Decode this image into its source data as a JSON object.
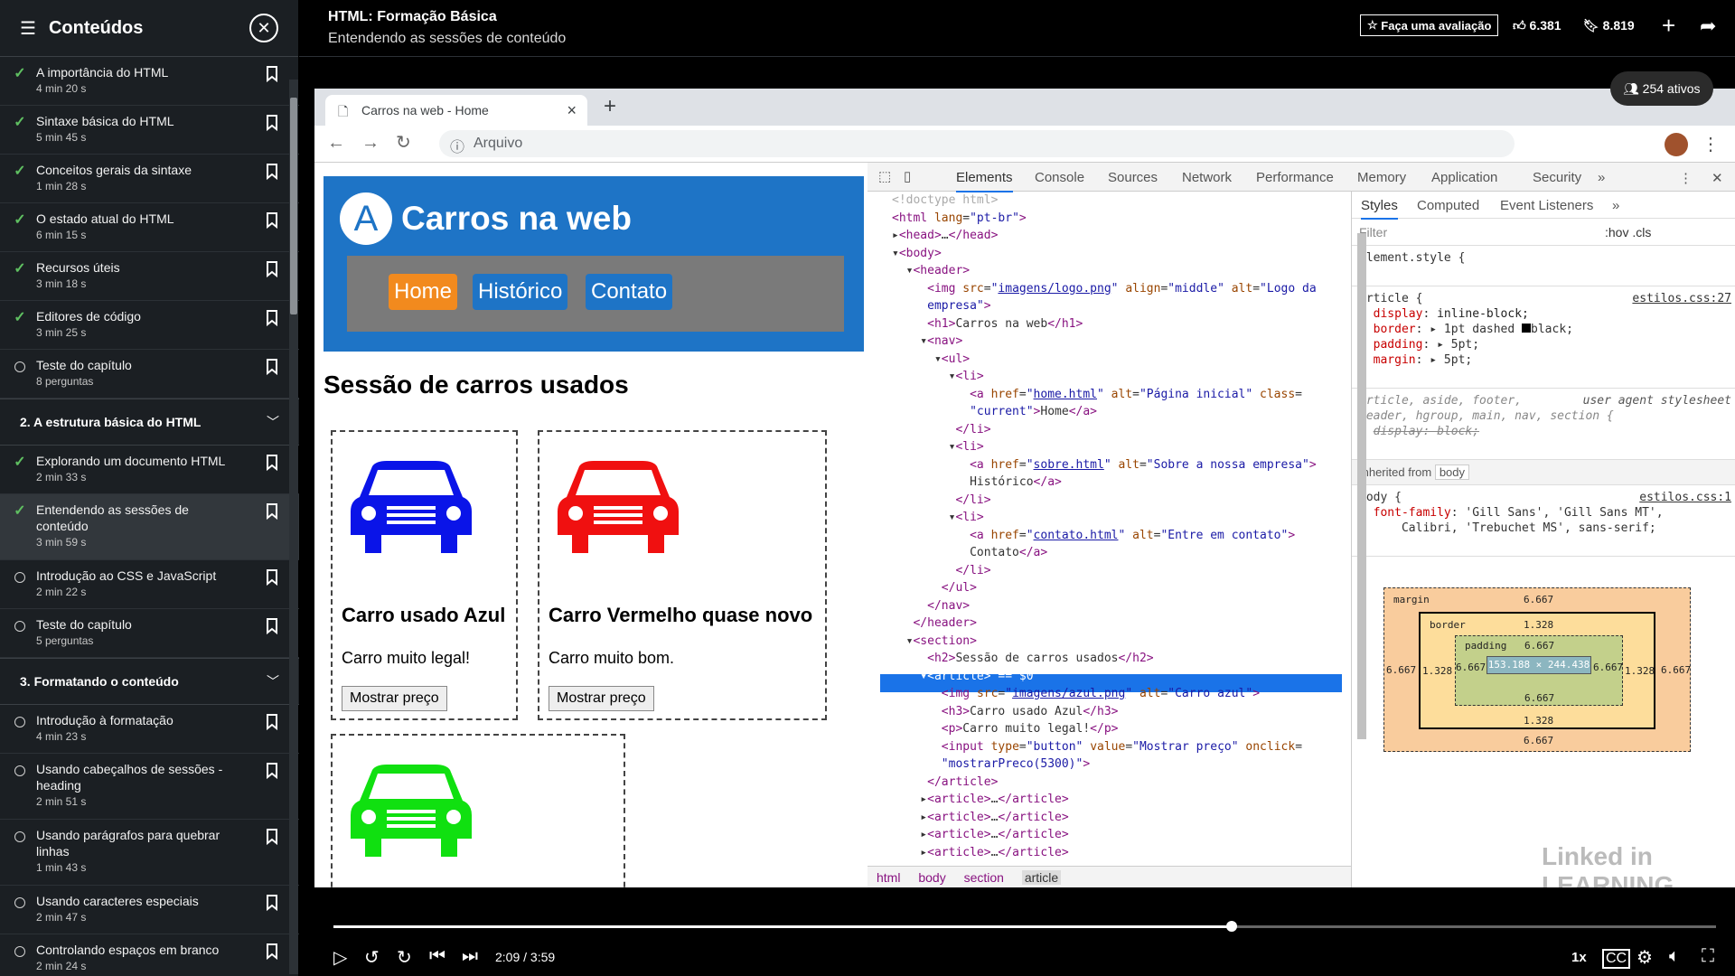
{
  "sidebar": {
    "title": "Conteúdos",
    "lessons_a": [
      {
        "title": "A importância do HTML",
        "dur": "4 min 20 s",
        "done": true
      },
      {
        "title": "Sintaxe básica do HTML",
        "dur": "5 min 45 s",
        "done": true
      },
      {
        "title": "Conceitos gerais da sintaxe",
        "dur": "1 min 28 s",
        "done": true
      },
      {
        "title": "O estado atual do HTML",
        "dur": "6 min 15 s",
        "done": true
      },
      {
        "title": "Recursos úteis",
        "dur": "3 min 18 s",
        "done": true
      },
      {
        "title": "Editores de código",
        "dur": "3 min 25 s",
        "done": true
      },
      {
        "title": "Teste do capítulo",
        "dur": "8 perguntas",
        "done": false
      }
    ],
    "section2": "2. A estrutura básica do HTML",
    "lessons_b": [
      {
        "title": "Explorando um documento HTML",
        "dur": "2 min 33 s",
        "done": true
      },
      {
        "title": "Entendendo as sessões de conteúdo",
        "dur": "3 min 59 s",
        "done": true
      },
      {
        "title": "Introdução ao CSS e JavaScript",
        "dur": "2 min 22 s",
        "done": false
      },
      {
        "title": "Teste do capítulo",
        "dur": "5 perguntas",
        "done": false
      }
    ],
    "section3": "3. Formatando o conteúdo",
    "lessons_c": [
      {
        "title": "Introdução à formatação",
        "dur": "4 min 23 s",
        "done": false
      },
      {
        "title": "Usando cabeçalhos de sessões - heading",
        "dur": "2 min 51 s",
        "done": false
      },
      {
        "title": "Usando parágrafos para quebrar linhas",
        "dur": "1 min 43 s",
        "done": false
      },
      {
        "title": "Usando caracteres especiais",
        "dur": "2 min 47 s",
        "done": false
      },
      {
        "title": "Controlando espaços em branco",
        "dur": "2 min 24 s",
        "done": false
      }
    ]
  },
  "header": {
    "course": "HTML: Formação Básica",
    "chapter": "Entendendo as sessões de conteúdo",
    "rate": "Faça uma avaliação",
    "likes": "6.381",
    "saves": "8.819"
  },
  "active": "254 ativos",
  "browser": {
    "tab": "Carros na web - Home",
    "address": "Arquivo"
  },
  "site": {
    "logo": "A",
    "name": "Carros na web",
    "nav": [
      "Home",
      "Histórico",
      "Contato"
    ],
    "section": "Sessão de carros usados",
    "cars": [
      {
        "title": "Carro usado Azul",
        "text": "Carro muito legal!",
        "button": "Mostrar preço"
      },
      {
        "title": "Carro Vermelho quase novo",
        "text": "Carro muito bom.",
        "button": "Mostrar preço"
      }
    ]
  },
  "devtools": {
    "tabs": [
      "Elements",
      "Console",
      "Sources",
      "Network",
      "Performance",
      "Memory",
      "Application",
      "Security"
    ],
    "style_tabs": [
      "Styles",
      "Computed",
      "Event Listeners"
    ],
    "filter": "Filter",
    "hov": ":hov .cls",
    "crumbs": [
      "html",
      "body",
      "section",
      "article"
    ],
    "element_style": "element.style {",
    "article_src": "estilos.css:27",
    "body_src": "estilos.css:1",
    "inherited": "Inherited from",
    "inherited_el": "body",
    "ua": "user agent stylesheet",
    "boxmodel": {
      "margin": "6.667",
      "border": "1.328",
      "padding": "6.667",
      "content": "153.188 × 244.438"
    }
  },
  "watermark": "Linked in LEARNING",
  "player": {
    "time": "2:09 / 3:59",
    "speed": "1x",
    "progress": 0.65
  }
}
